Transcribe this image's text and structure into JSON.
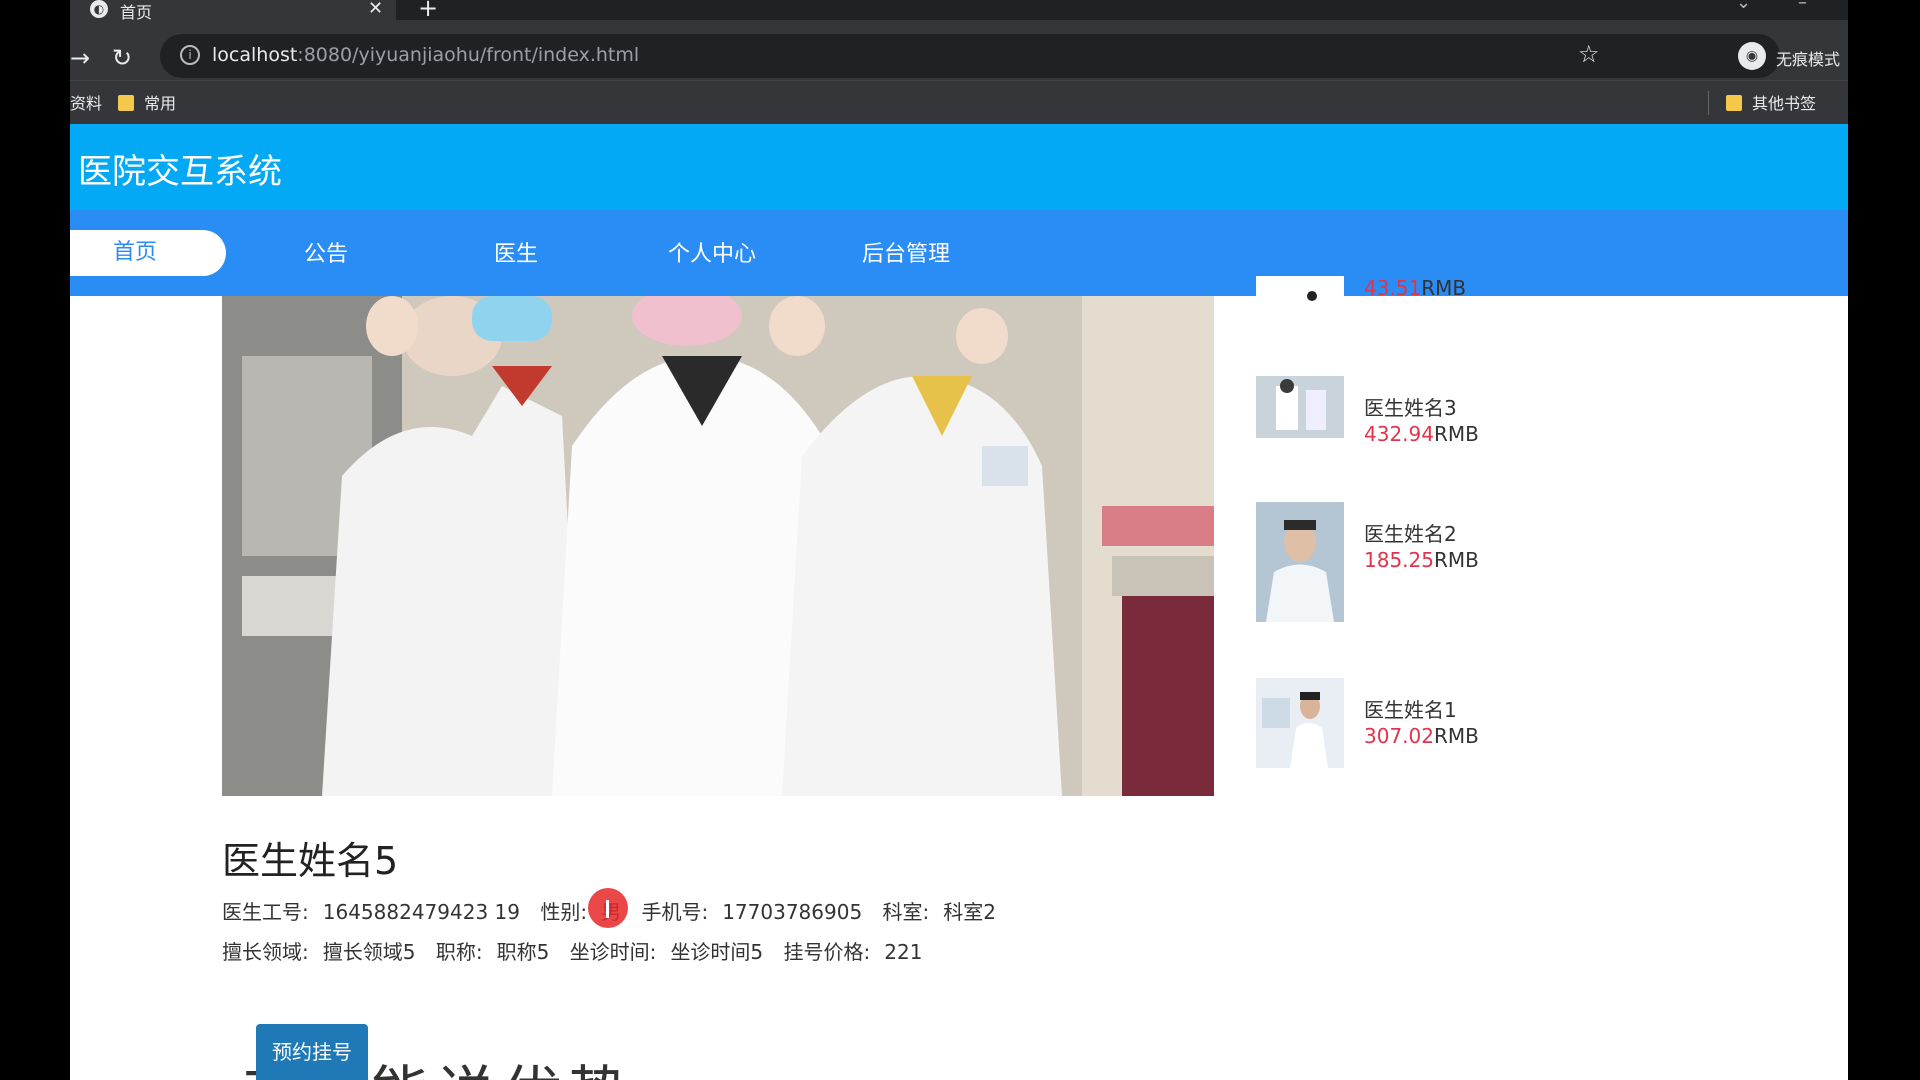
{
  "browser": {
    "tab_title": "首页",
    "tab_close": "✕",
    "new_tab": "+",
    "url_host": "localhost",
    "url_rest": ":8080/yiyuanjiaohu/front/index.html",
    "incognito_label": "无痕模式",
    "bookmarks": [
      {
        "label": "资料"
      },
      {
        "label": "常用"
      },
      {
        "label": "其他书签"
      }
    ]
  },
  "site": {
    "title": "医院交互系统",
    "nav": [
      "首页",
      "公告",
      "医生",
      "个人中心",
      "后台管理"
    ],
    "active_nav": "首页"
  },
  "doctor": {
    "name": "医生姓名5",
    "line1": [
      {
        "k": "医生工号:",
        "v": "1645882479423 19"
      },
      {
        "k": "性别:",
        "v": "男"
      },
      {
        "k": "手机号:",
        "v": "17703786905"
      },
      {
        "k": "科室:",
        "v": "科室2"
      }
    ],
    "line2": [
      {
        "k": "擅长领域:",
        "v": "擅长领域5"
      },
      {
        "k": "职称:",
        "v": "职称5"
      },
      {
        "k": "坐诊时间:",
        "v": "坐诊时间5"
      },
      {
        "k": "挂号价格:",
        "v": "221"
      }
    ],
    "reserve_button": "预约挂号",
    "section_heading": "专业能说优势"
  },
  "side_doctors": [
    {
      "name": "",
      "price": "43.51",
      "unit": "RMB"
    },
    {
      "name": "医生姓名3",
      "price": "432.94",
      "unit": "RMB"
    },
    {
      "name": "医生姓名2",
      "price": "185.25",
      "unit": "RMB"
    },
    {
      "name": "医生姓名1",
      "price": "307.02",
      "unit": "RMB"
    }
  ],
  "colors": {
    "header": "#03a9f4",
    "nav": "#2a8cf5",
    "price": "#e0344b",
    "reserve_button": "#1f79b7"
  }
}
